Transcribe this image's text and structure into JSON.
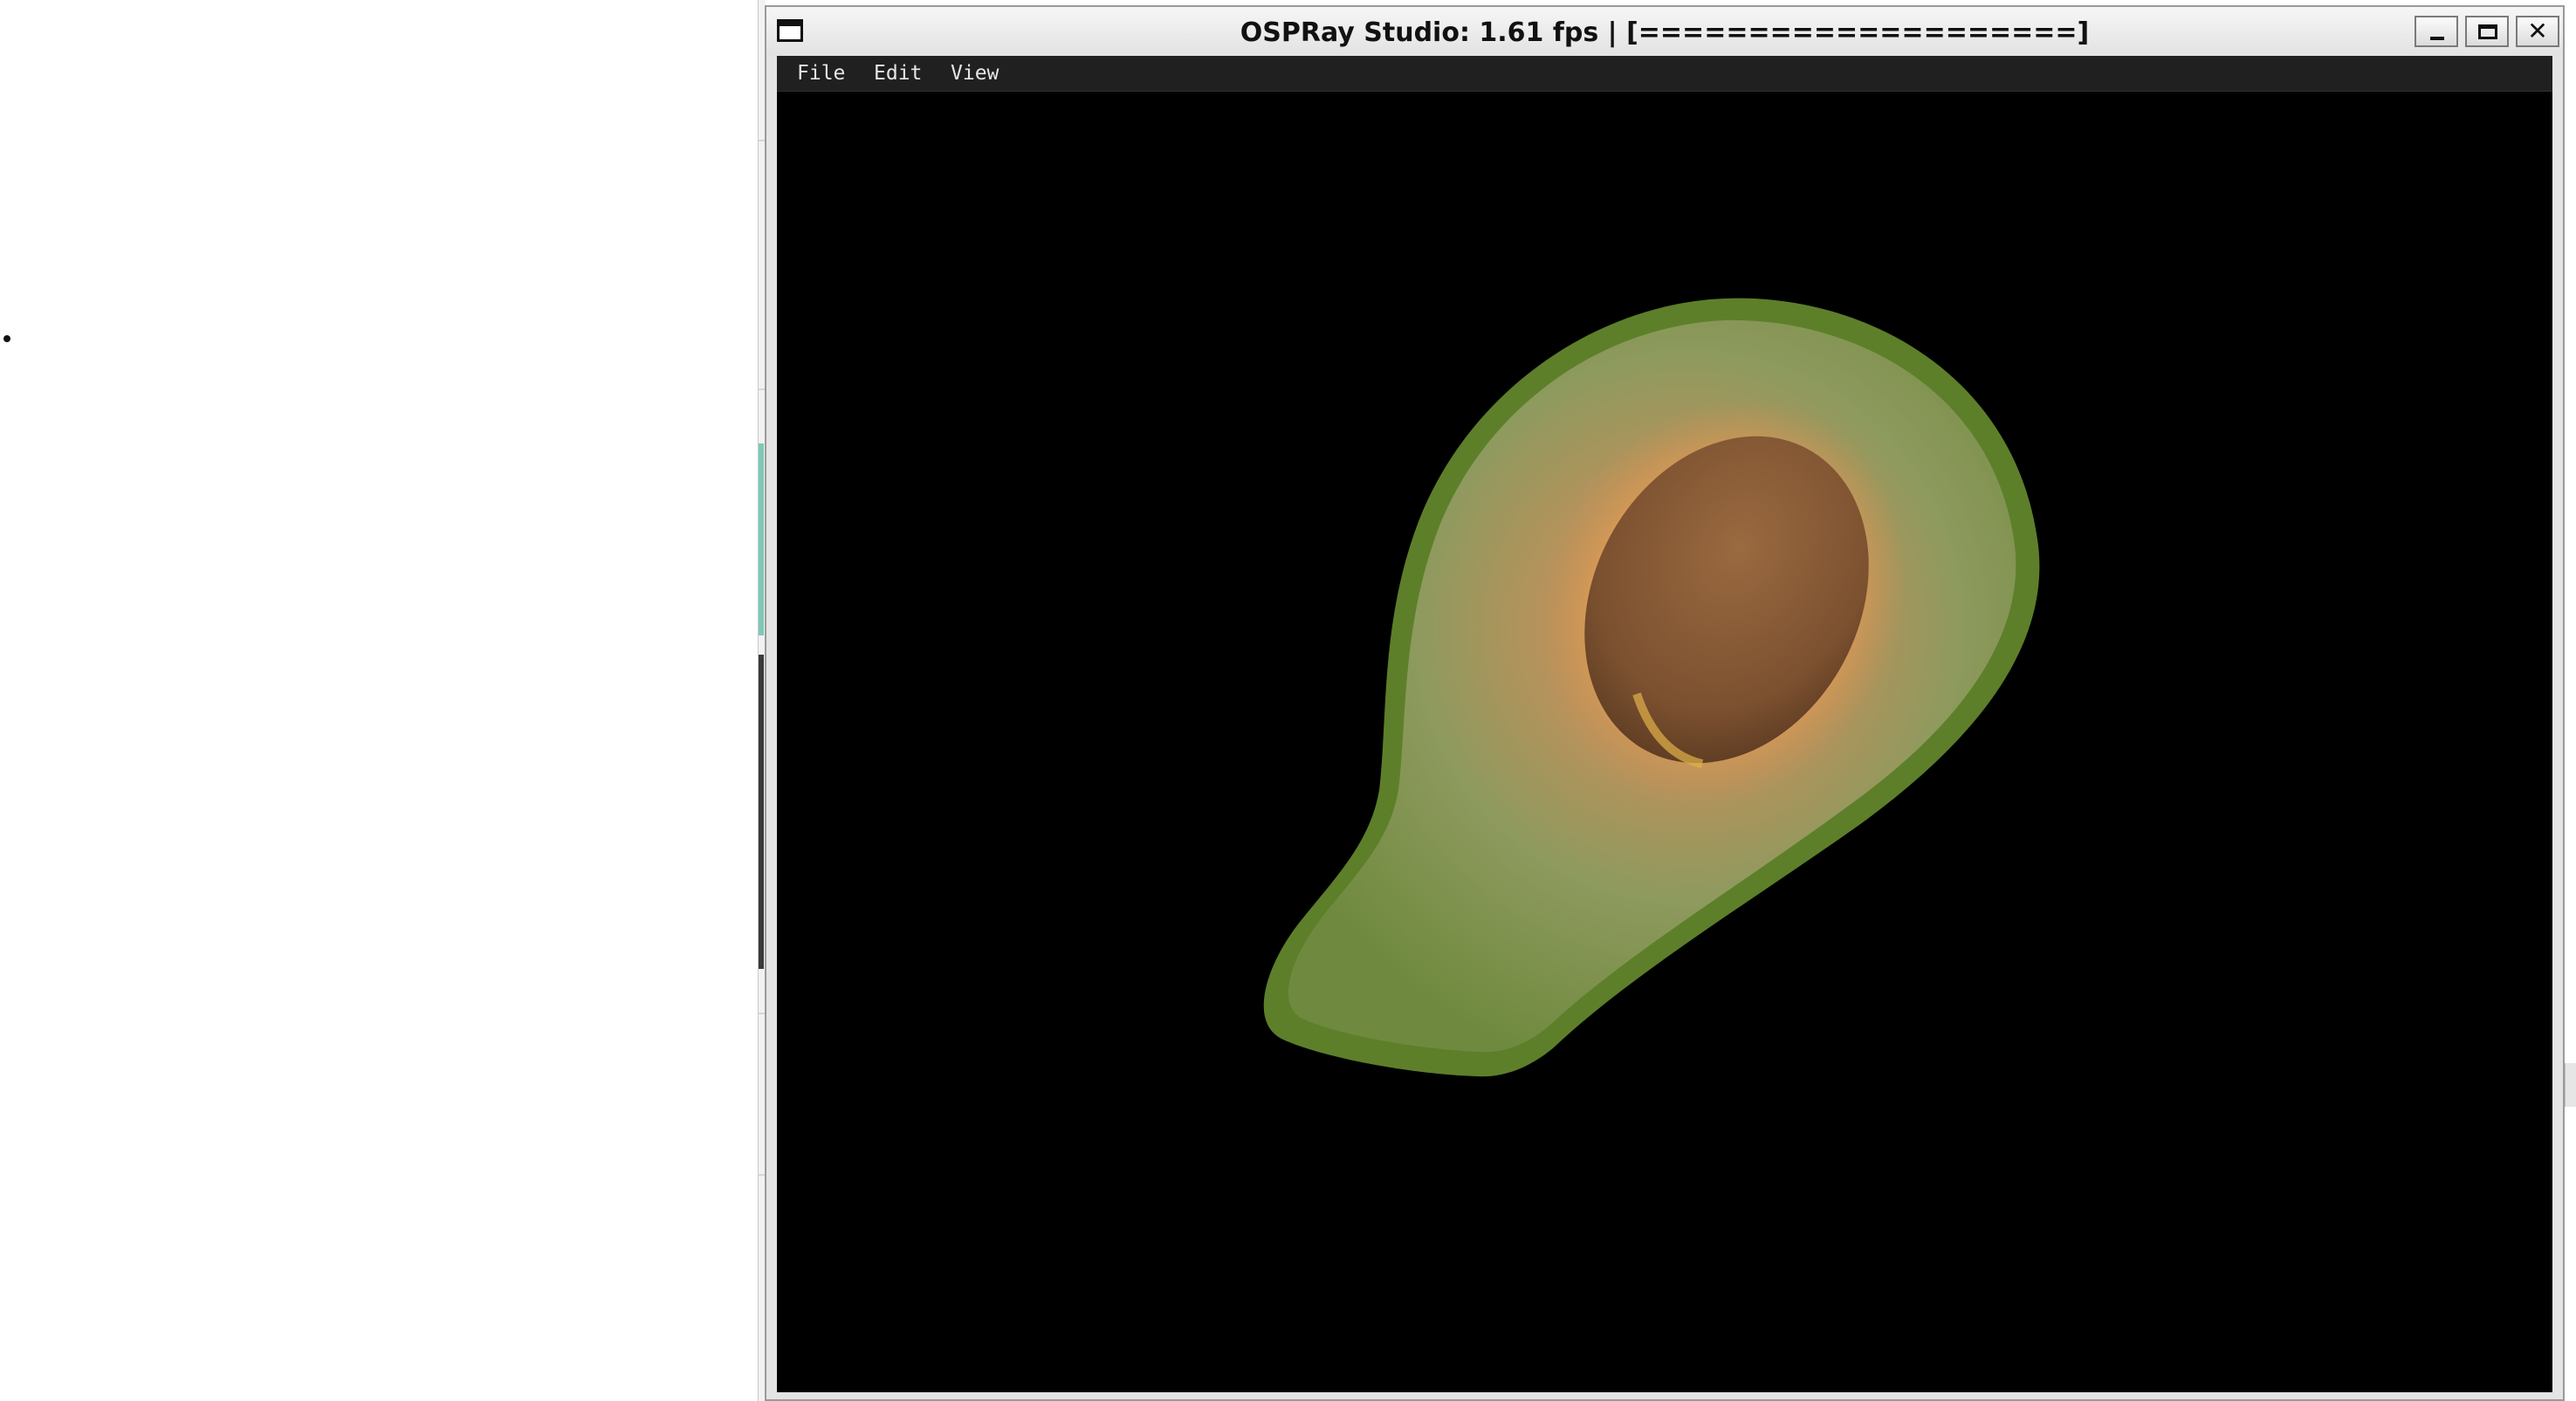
{
  "window": {
    "title": "OSPRay Studio: 1.61 fps | [====================]",
    "close_glyph": "✕"
  },
  "menubar": {
    "items": [
      {
        "label": "File"
      },
      {
        "label": "Edit"
      },
      {
        "label": "View"
      }
    ]
  },
  "viewport": {
    "background_color": "#000000",
    "scene_object": "avocado-half"
  },
  "colors": {
    "skin": "#5b7d2c",
    "flesh": "#8fa25a",
    "flesh_inner": "#b88a4e",
    "pit": "#8a5a34"
  }
}
